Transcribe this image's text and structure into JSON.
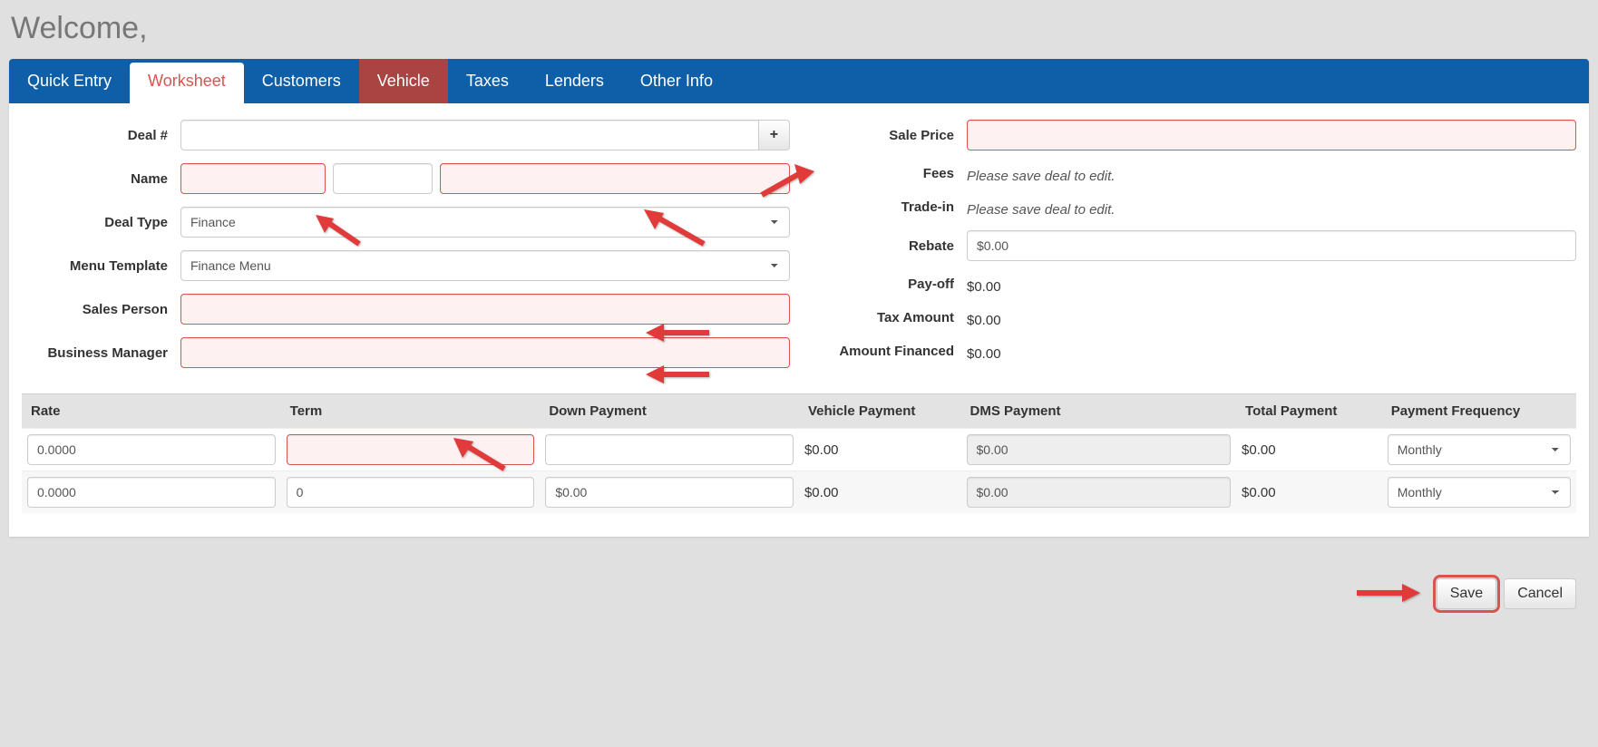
{
  "welcome": "Welcome,",
  "tabs": {
    "quick_entry": "Quick Entry",
    "worksheet": "Worksheet",
    "customers": "Customers",
    "vehicle": "Vehicle",
    "taxes": "Taxes",
    "lenders": "Lenders",
    "other_info": "Other Info"
  },
  "left": {
    "deal_no_label": "Deal #",
    "deal_no_value": "",
    "plus_label": "+",
    "name_label": "Name",
    "name_first": "",
    "name_mid": "",
    "name_last": "",
    "deal_type_label": "Deal Type",
    "deal_type_value": "Finance",
    "menu_template_label": "Menu Template",
    "menu_template_value": "Finance Menu",
    "sales_person_label": "Sales Person",
    "sales_person_value": "",
    "business_manager_label": "Business Manager",
    "business_manager_value": ""
  },
  "right": {
    "sale_price_label": "Sale Price",
    "sale_price_value": "",
    "fees_label": "Fees",
    "fees_text": "Please save deal to edit.",
    "trade_in_label": "Trade-in",
    "trade_in_text": "Please save deal to edit.",
    "rebate_label": "Rebate",
    "rebate_value": "$0.00",
    "payoff_label": "Pay-off",
    "payoff_value": "$0.00",
    "tax_amount_label": "Tax Amount",
    "tax_amount_value": "$0.00",
    "amount_financed_label": "Amount Financed",
    "amount_financed_value": "$0.00"
  },
  "table": {
    "headers": {
      "rate": "Rate",
      "term": "Term",
      "down_payment": "Down Payment",
      "vehicle_payment": "Vehicle Payment",
      "dms_payment": "DMS Payment",
      "total_payment": "Total Payment",
      "payment_frequency": "Payment Frequency"
    },
    "rows": [
      {
        "rate": "0.0000",
        "term": "",
        "down_payment": "",
        "vehicle_payment": "$0.00",
        "dms_payment": "$0.00",
        "total_payment": "$0.00",
        "payment_frequency": "Monthly",
        "term_error": true
      },
      {
        "rate": "0.0000",
        "term": "0",
        "down_payment": "$0.00",
        "vehicle_payment": "$0.00",
        "dms_payment": "$0.00",
        "total_payment": "$0.00",
        "payment_frequency": "Monthly",
        "term_error": false
      }
    ]
  },
  "footer": {
    "save": "Save",
    "cancel": "Cancel"
  }
}
